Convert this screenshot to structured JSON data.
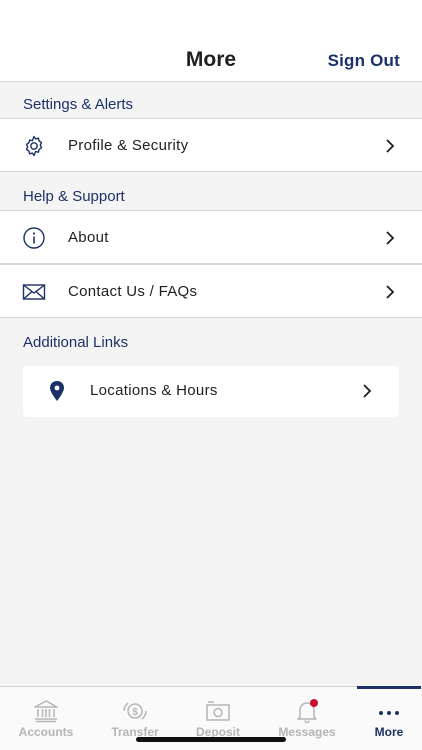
{
  "header": {
    "title": "More",
    "sign_out": "Sign Out"
  },
  "sections": {
    "settings": {
      "label": "Settings & Alerts",
      "items": [
        {
          "label": "Profile & Security",
          "icon": "gear-icon"
        }
      ]
    },
    "help": {
      "label": "Help & Support",
      "items": [
        {
          "label": "About",
          "icon": "info-icon"
        },
        {
          "label": "Contact Us / FAQs",
          "icon": "envelope-icon"
        }
      ]
    },
    "links": {
      "label": "Additional Links",
      "items": [
        {
          "label": "Locations & Hours",
          "icon": "location-pin-icon"
        }
      ]
    }
  },
  "tabs": [
    {
      "label": "Accounts",
      "icon": "bank-icon",
      "active": false
    },
    {
      "label": "Transfer",
      "icon": "transfer-dollar-icon",
      "active": false
    },
    {
      "label": "Deposit",
      "icon": "camera-icon",
      "active": false
    },
    {
      "label": "Messages",
      "icon": "bell-icon",
      "active": false,
      "badge": true
    },
    {
      "label": "More",
      "icon": "more-dots-icon",
      "active": true
    }
  ],
  "colors": {
    "accent": "#1c3166",
    "badge": "#c8102e",
    "inactive_tab": "#b5b5b5"
  }
}
